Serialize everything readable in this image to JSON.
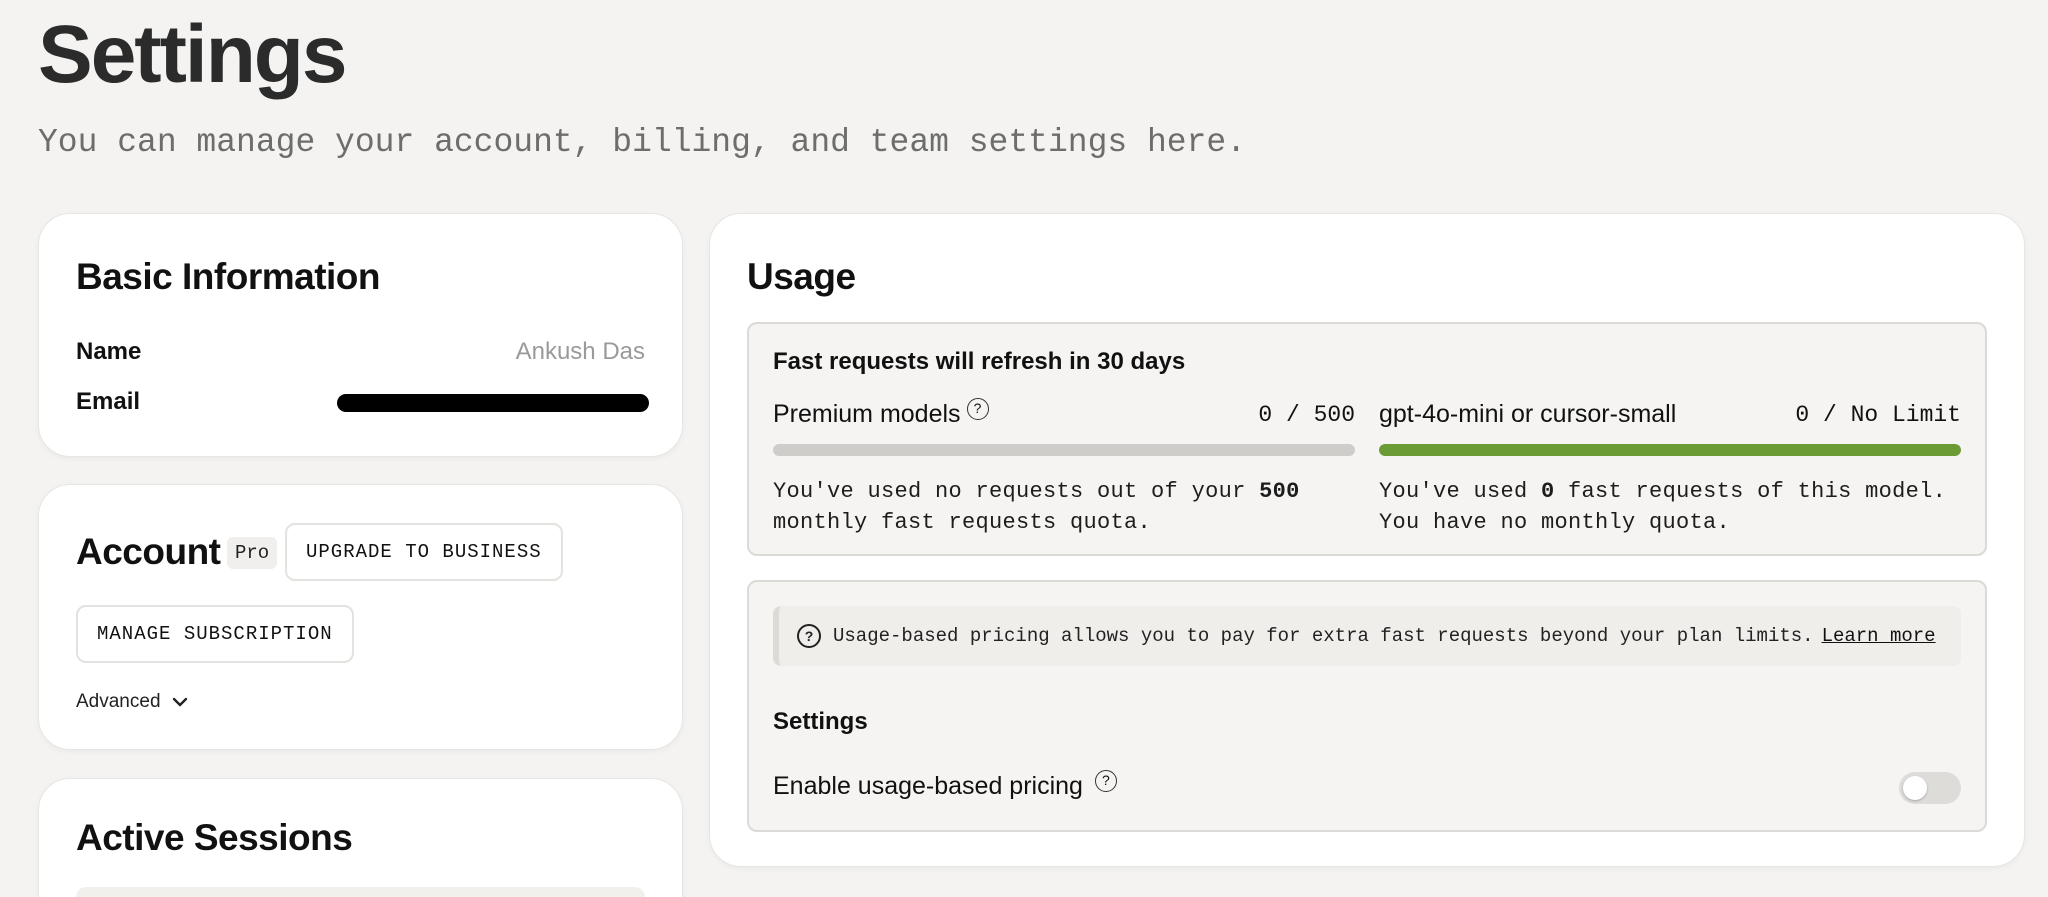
{
  "page": {
    "title": "Settings",
    "subtitle": "You can manage your account, billing, and team settings here."
  },
  "basic_info": {
    "title": "Basic Information",
    "name_label": "Name",
    "name_value": "Ankush Das",
    "email_label": "Email"
  },
  "account": {
    "title": "Account",
    "plan_badge": "Pro",
    "upgrade_label": "UPGRADE TO BUSINESS",
    "manage_label": "MANAGE SUBSCRIPTION",
    "advanced_label": "Advanced",
    "advanced_icon": "chevron-down-icon"
  },
  "sessions": {
    "title": "Active Sessions"
  },
  "usage": {
    "title": "Usage",
    "refresh_text": "Fast requests will refresh in 30 days",
    "premium": {
      "name": "Premium models",
      "count": "0 / 500",
      "progress": 0,
      "desc_prefix": "You've used no requests out of your ",
      "desc_bold": "500",
      "desc_suffix": " monthly fast requests quota.",
      "bar_color": "#cfcdca"
    },
    "mini": {
      "name": "gpt-4o-mini or cursor-small",
      "count": "0 / No Limit",
      "progress": 1,
      "desc_prefix": "You've used ",
      "desc_bold": "0",
      "desc_suffix": " fast requests of this model. You have no monthly quota.",
      "bar_color": "#6b9b35"
    },
    "pricing_note": "Usage-based pricing allows you to pay for extra fast requests beyond your plan limits.",
    "learn_more": "Learn more",
    "settings_title": "Settings",
    "toggle_label": "Enable usage-based pricing",
    "toggle_on": false
  },
  "help_glyph": "?"
}
